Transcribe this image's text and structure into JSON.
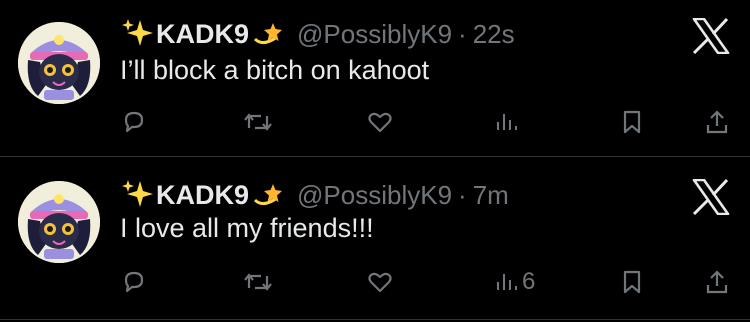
{
  "colors": {
    "background": "#000000",
    "text_primary": "#e7e9ea",
    "text_secondary": "#71767b",
    "divider": "#2f3336"
  },
  "tweets": [
    {
      "display_name": "KADK9",
      "handle": "@PossiblyK9",
      "separator": "·",
      "time": "22s",
      "text": "I’ll block a bitch on kahoot",
      "views": ""
    },
    {
      "display_name": "KADK9",
      "handle": "@PossiblyK9",
      "separator": "·",
      "time": "7m",
      "text": "I love all my friends!!!",
      "views": "6"
    }
  ],
  "icons": {
    "name_prefix": "sparkles-emoji",
    "name_suffix": "dizzy-emoji",
    "logo": "x-logo-icon",
    "actions": [
      "reply-icon",
      "retweet-icon",
      "like-icon",
      "views-icon",
      "bookmark-icon",
      "share-icon"
    ]
  }
}
